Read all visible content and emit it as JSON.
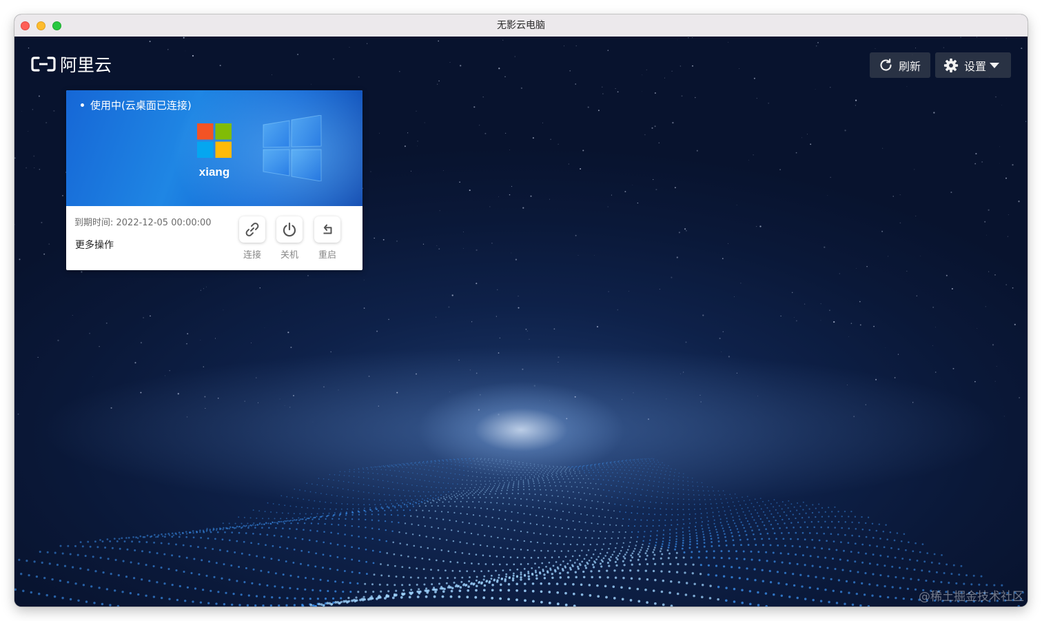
{
  "window": {
    "title": "无影云电脑"
  },
  "brand": {
    "logo_text": "阿里云",
    "logo_icon": "aliyun-logo-icon"
  },
  "toolbar": {
    "refresh_label": "刷新",
    "refresh_icon": "refresh-icon",
    "settings_label": "设置",
    "settings_icon": "gear-icon"
  },
  "desktop_card": {
    "status": "使用中(云桌面已连接)",
    "username": "xiang",
    "os_icon": "windows-logo-icon",
    "expire_text": "到期时间: 2022-12-05 00:00:00",
    "more_ops_label": "更多操作",
    "actions": [
      {
        "label": "连接",
        "icon": "link-icon"
      },
      {
        "label": "关机",
        "icon": "power-icon"
      },
      {
        "label": "重启",
        "icon": "restart-icon"
      }
    ]
  },
  "watermark": "@稀土掘金技术社区",
  "colors": {
    "banner_blue": "#1f86e4",
    "background_navy": "#0b1836",
    "button_bg": "#2d3546",
    "traffic_close": "#fe5f57",
    "traffic_min": "#febc2e",
    "traffic_max": "#28c840"
  }
}
